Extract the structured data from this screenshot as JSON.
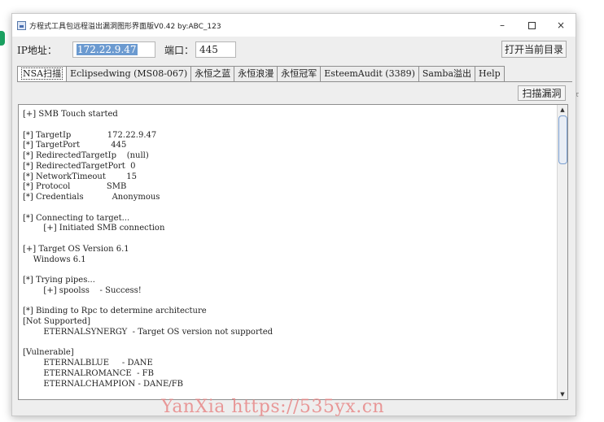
{
  "window": {
    "title": "方程式工具包远程溢出漏洞图形界面版V0.42 by:ABC_123",
    "controls": {
      "minimize": "–",
      "close": "×"
    }
  },
  "toolbar": {
    "ip_label": "IP地址：",
    "ip_value": "172.22.9.47",
    "port_label": "端口：",
    "port_value": "445",
    "open_dir_button": "打开当前目录"
  },
  "tabs": [
    {
      "label": "NSA扫描",
      "active": true
    },
    {
      "label": "Eclipsedwing (MS08-067)",
      "active": false
    },
    {
      "label": "永恒之蓝",
      "active": false
    },
    {
      "label": "永恒浪漫",
      "active": false
    },
    {
      "label": "永恒冠军",
      "active": false
    },
    {
      "label": "EsteemAudit (3389)",
      "active": false
    },
    {
      "label": "Samba溢出",
      "active": false
    },
    {
      "label": "Help",
      "active": false
    }
  ],
  "scan_button": "扫描漏洞",
  "console": {
    "lines": [
      "[+] SMB Touch started",
      "",
      "[*] TargetIp              172.22.9.47",
      "[*] TargetPort            445",
      "[*] RedirectedTargetIp    (null)",
      "[*] RedirectedTargetPort  0",
      "[*] NetworkTimeout        15",
      "[*] Protocol              SMB",
      "[*] Credentials           Anonymous",
      "",
      "[*] Connecting to target...",
      "        [+] Initiated SMB connection",
      "",
      "[+] Target OS Version 6.1",
      "    Windows 6.1",
      "",
      "[*] Trying pipes...",
      "        [+] spoolss    - Success!",
      "",
      "[*] Binding to Rpc to determine architecture",
      "[Not Supported]",
      "        ETERNALSYNERGY  - Target OS version not supported",
      "",
      "[Vulnerable]",
      "        ETERNALBLUE     - DANE",
      "        ETERNALROMANCE  - FB",
      "        ETERNALCHAMPION - DANE/FB"
    ]
  },
  "watermark": "YanXia https://535yx.cn"
}
